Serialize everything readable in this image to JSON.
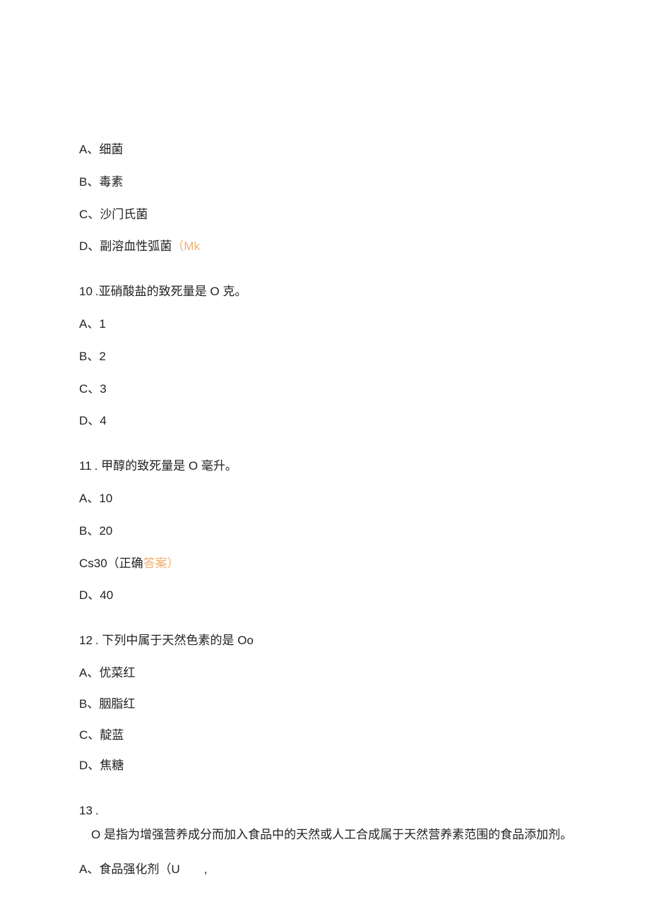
{
  "q9": {
    "optA_prefix": "A、",
    "optA_text": "细菌",
    "optB_prefix": "B、",
    "optB_text": "毒素",
    "optC_prefix": "C、",
    "optC_text": "沙门氏菌",
    "optD_prefix": "D、",
    "optD_text": "副溶血性弧菌",
    "optD_ans": "（Mk"
  },
  "q10": {
    "num": "10",
    "stem": ".亚硝酸盐的致死量是 O 克。",
    "optA": "A、1",
    "optB": "B、2",
    "optC": "C、3",
    "optD": "D、4"
  },
  "q11": {
    "num": "11",
    "stem": ". 甲醇的致死量是 O 毫升。",
    "optA": "A、10",
    "optB": "B、20",
    "optC_text": "Cs30（正确",
    "optC_ans": "答案）",
    "optD": "D、40"
  },
  "q12": {
    "num": "12",
    "stem": ". 下列中属于天然色素的是 Oo",
    "optA_prefix": "A、",
    "optA_text": "优菜红",
    "optB_prefix": "B、",
    "optB_text": "胭脂红",
    "optC_prefix": "C、",
    "optC_text": "靛蓝",
    "optD_prefix": "D、",
    "optD_text": "焦糖"
  },
  "q13": {
    "num": "13",
    "stem": ".",
    "desc": "O 是指为增强营养成分而加入食品中的天然或人工合成属于天然营养素范围的食品添加剂。",
    "optA_prefix": "A、",
    "optA_text": "食品强化剂（U  ,"
  }
}
